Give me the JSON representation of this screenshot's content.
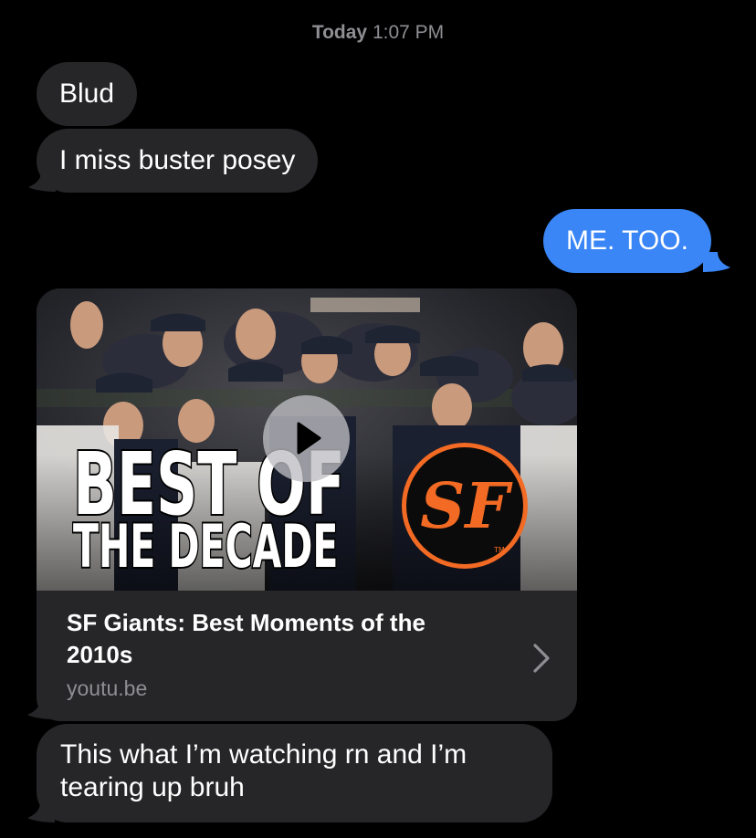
{
  "header": {
    "timestamp_day": "Today",
    "timestamp_time": "1:07 PM"
  },
  "messages": [
    {
      "direction": "incoming",
      "text": "Blud"
    },
    {
      "direction": "incoming",
      "text": "I miss buster posey"
    },
    {
      "direction": "outgoing",
      "text": "ME. TOO."
    },
    {
      "direction": "incoming",
      "text": "This what I’m watching rn and I’m tearing up bruh"
    }
  ],
  "link_preview": {
    "title": "SF Giants: Best Moments of the 2010s",
    "domain": "youtu.be",
    "thumbnail_text_line1": "BEST OF",
    "thumbnail_text_line2": "THE DECADE",
    "thumbnail_logo": "SF",
    "thumbnail_logo_mark": "TM"
  },
  "icons": {
    "play": "play-icon",
    "chevron": "chevron-right-icon"
  },
  "colors": {
    "background": "#000000",
    "incoming_bubble": "#262628",
    "outgoing_bubble": "#3a86f6",
    "timestamp": "#8e8e93",
    "logo_orange": "#f26a23"
  }
}
